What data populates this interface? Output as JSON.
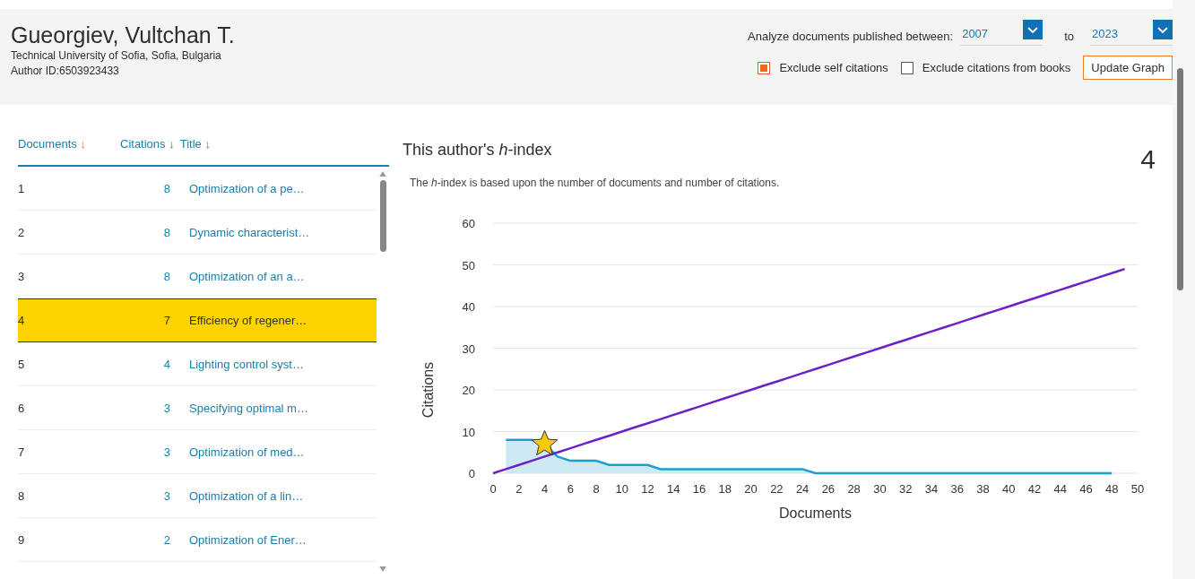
{
  "author": {
    "name": "Gueorgiev, Vultchan T.",
    "affiliation": "Technical University of Sofia, Sofia, Bulgaria",
    "author_id": "Author ID:6503923433"
  },
  "filters": {
    "range_label": "Analyze documents published between:",
    "from": {
      "value": "2007"
    },
    "to_label": "to",
    "to": {
      "value": "2023"
    },
    "checkboxes": [
      {
        "label": "Exclude self citations",
        "checked": true
      },
      {
        "label": "Exclude citations from books",
        "checked": false
      }
    ],
    "button": "Update Graph"
  },
  "table": {
    "columns": [
      {
        "label": "Documents",
        "arrow": "↓",
        "selected": true
      },
      {
        "label": "Citations",
        "arrow": "↓",
        "selected": false
      },
      {
        "label": "Title",
        "arrow": "↓",
        "selected": false
      }
    ],
    "rows": [
      {
        "rank": "1",
        "citations": "8",
        "title": "Optimization of a pe…",
        "selected": false
      },
      {
        "rank": "2",
        "citations": "8",
        "title": "Dynamic characterist…",
        "selected": false
      },
      {
        "rank": "3",
        "citations": "8",
        "title": "Optimization of an a…",
        "selected": false
      },
      {
        "rank": "4",
        "citations": "7",
        "title": "Efficiency of regener…",
        "selected": true
      },
      {
        "rank": "5",
        "citations": "4",
        "title": "Lighting control syst…",
        "selected": false
      },
      {
        "rank": "6",
        "citations": "3",
        "title": "Specifying optimal m…",
        "selected": false
      },
      {
        "rank": "7",
        "citations": "3",
        "title": "Optimization of med…",
        "selected": false
      },
      {
        "rank": "8",
        "citations": "3",
        "title": "Optimization of a lin…",
        "selected": false
      },
      {
        "rank": "9",
        "citations": "2",
        "title": "Optimization of Ener…",
        "selected": false
      }
    ]
  },
  "h_index": {
    "title": "This author's *h*-index",
    "value": "4",
    "description": "The *h*-index is based upon the number of documents and number of citations.",
    "chart_data": {
      "type": "line",
      "xlabel": "Documents",
      "ylabel": "Citations",
      "x": [
        0,
        1,
        2,
        3,
        4,
        5,
        6,
        7,
        8,
        9,
        10,
        11,
        12,
        13,
        14,
        15,
        16,
        17,
        18,
        19,
        20,
        21,
        22,
        23,
        24,
        25,
        26,
        27,
        28,
        29,
        30,
        31,
        32,
        33,
        34,
        35,
        36,
        37,
        38,
        39,
        40,
        41,
        42,
        43,
        44,
        45,
        46,
        47,
        48,
        49
      ],
      "series": [
        {
          "color": "#1a9fd0",
          "values": [
            null,
            8,
            8,
            8,
            7,
            4,
            3,
            3,
            3,
            2,
            2,
            2,
            2,
            1,
            1,
            1,
            1,
            1,
            1,
            1,
            1,
            1,
            1,
            1,
            1,
            0,
            0,
            0,
            0,
            0,
            0,
            0,
            0,
            0,
            0,
            0,
            0,
            0,
            0,
            0,
            0,
            0,
            0,
            0,
            0,
            0,
            0,
            0,
            0,
            null
          ]
        },
        {
          "color": "#6a22c8",
          "values": [
            0,
            1,
            2,
            3,
            4,
            5,
            6,
            7,
            8,
            9,
            10,
            11,
            12,
            13,
            14,
            15,
            16,
            17,
            18,
            19,
            20,
            21,
            22,
            23,
            24,
            25,
            26,
            27,
            28,
            29,
            30,
            31,
            32,
            33,
            34,
            35,
            36,
            37,
            38,
            39,
            40,
            41,
            42,
            43,
            44,
            45,
            46,
            47,
            48,
            49
          ]
        }
      ],
      "xlim": [
        0,
        50
      ],
      "ylim": [
        0,
        60
      ],
      "xticks": [
        0,
        2,
        4,
        6,
        8,
        10,
        12,
        14,
        16,
        18,
        20,
        22,
        24,
        26,
        28,
        30,
        32,
        34,
        36,
        38,
        40,
        42,
        44,
        46,
        48,
        50
      ],
      "yticks": [
        0,
        10,
        20,
        30,
        40,
        50,
        60
      ],
      "grid": true
    }
  }
}
